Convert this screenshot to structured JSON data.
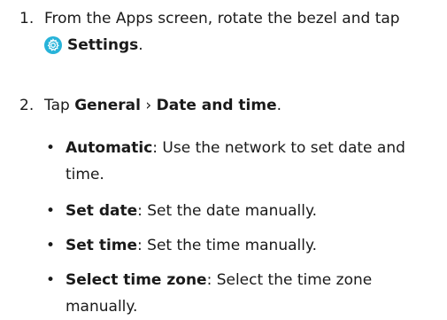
{
  "steps": [
    {
      "number": "1.",
      "line1": "From the Apps screen, rotate the bezel and tap",
      "icon": "settings-gear-icon",
      "icon_color": "#27b3d9",
      "emphasis": "Settings",
      "trailing": "."
    },
    {
      "number": "2.",
      "prefix": "Tap ",
      "emphasis1": "General",
      "separator": " › ",
      "emphasis2": "Date and time",
      "trailing": ".",
      "bullets": [
        {
          "marker": "•",
          "term": "Automatic",
          "description": ": Use the network to set date and time."
        },
        {
          "marker": "•",
          "term": "Set date",
          "description": ": Set the date manually."
        },
        {
          "marker": "•",
          "term": "Set time",
          "description": ": Set the time manually."
        },
        {
          "marker": "•",
          "term": "Select time zone",
          "description": ": Select the time zone manually."
        }
      ]
    }
  ]
}
